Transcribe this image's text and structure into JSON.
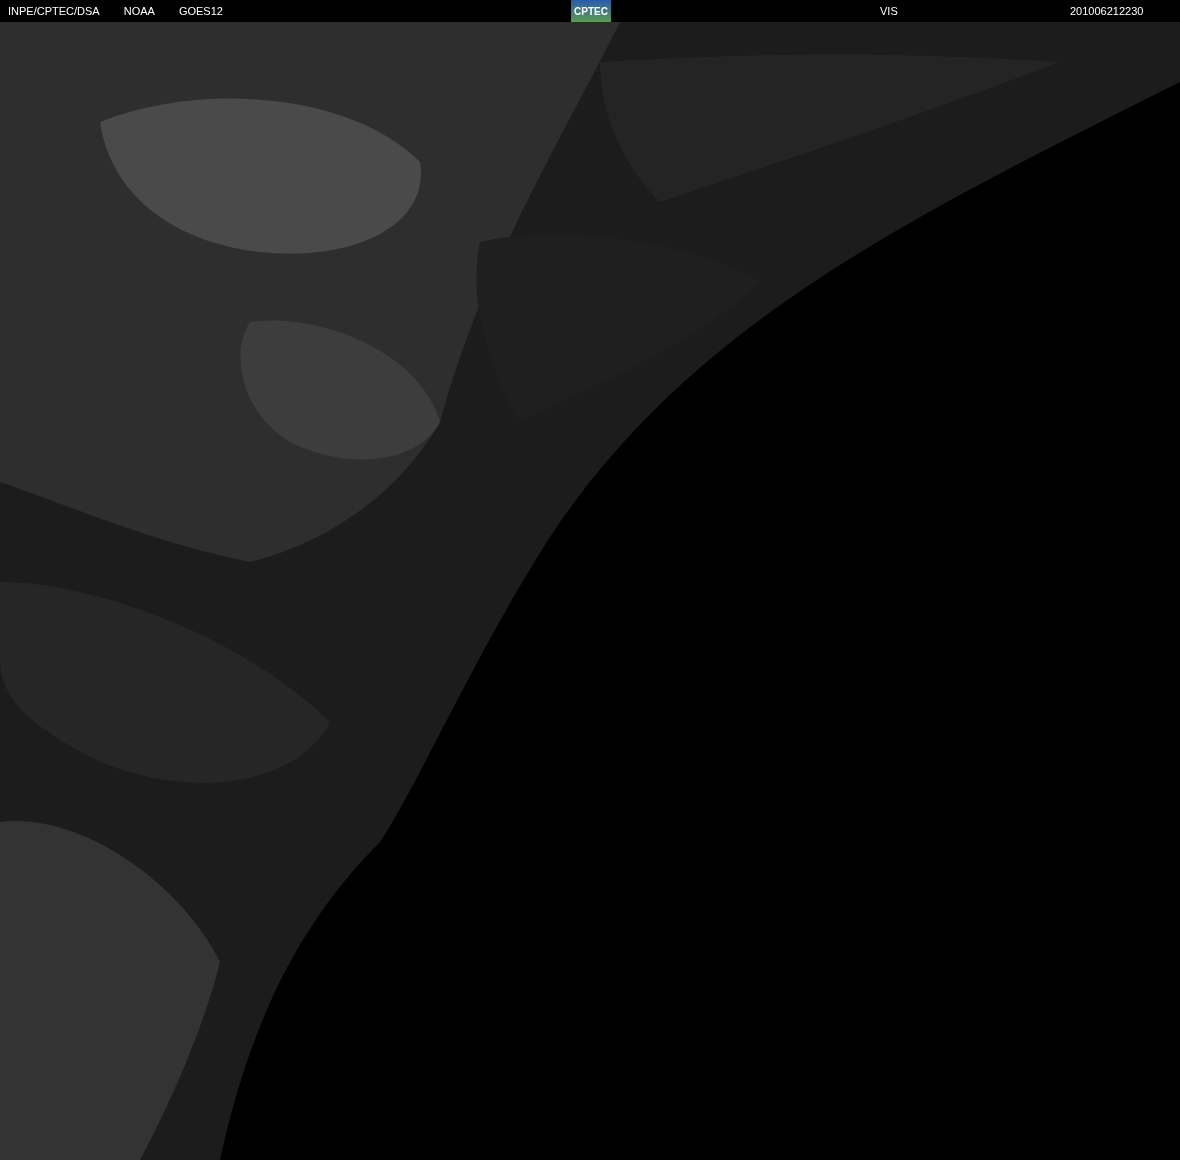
{
  "header": {
    "labels_left": [
      "INPE/CPTEC/DSA",
      "NOAA",
      "GOES12"
    ],
    "logo": "CPTEC",
    "channel": "VIS",
    "timestamp": "201006212230"
  }
}
